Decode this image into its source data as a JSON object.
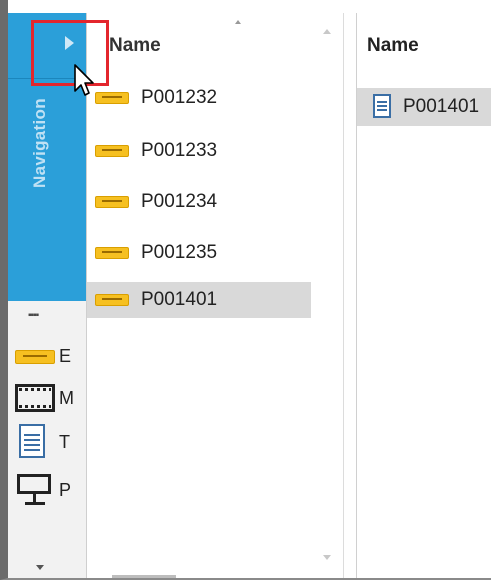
{
  "navigation": {
    "vertical_label": "Navigation",
    "items": [
      {
        "icon": "exhibit-icon",
        "label": "E"
      },
      {
        "icon": "film-icon",
        "label": "M"
      },
      {
        "icon": "document-icon",
        "label": "T"
      },
      {
        "icon": "presentation-icon",
        "label": "P"
      }
    ]
  },
  "middle_list": {
    "header": "Name",
    "rows": [
      "P001232",
      "P001233",
      "P001234",
      "P001235",
      "P001401"
    ],
    "selected": "P001401"
  },
  "right_pane": {
    "header": "Name",
    "row_label": "P001401"
  },
  "colors": {
    "nav_blue": "#2b9fd9",
    "highlight_red": "#e3262d",
    "selection_gray": "#d9d9d9",
    "exhibit_yellow": "#f6c021"
  }
}
